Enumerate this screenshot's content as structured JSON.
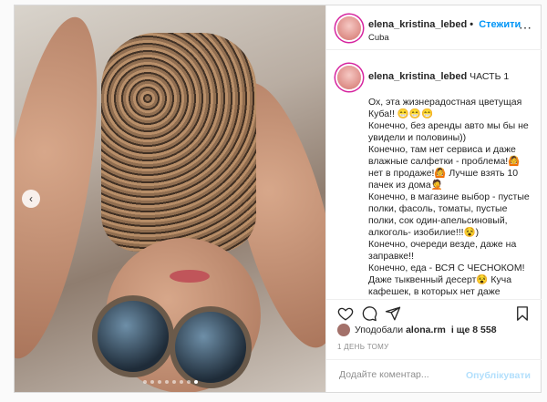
{
  "post": {
    "username": "elena_kristina_lebed",
    "follow_label": "Стежити",
    "location": "Cuba",
    "more_icon": "more-horizontal-icon"
  },
  "caption": {
    "username": "elena_kristina_lebed",
    "title": "ЧАСТЬ 1",
    "text": "Ох, эта жизнерадостная цветущая Куба!! 😁😁😁\nКонечно, без аренды авто мы бы не увидели и половины))\nКонечно, там нет сервиса и даже влажные салфетки - проблема!🙆 нет в продаже!🙆 Лучше взять 10 пачек из дома🤦\nКонечно, в магазине выбор - пустые полки, фасоль, томаты, пустые полки, сок один-апельсиновый, алкоголь- изобилие!!!😵)\nКонечно, очереди везде, даже на заправке!!\nКонечно, еда - ВСЯ С ЧЕСНОКОМ!\nДаже тыквенный десерт😵 Куча кафешек, в которых нет даже"
  },
  "likes": {
    "prefix": "Уподобали",
    "user": "alona.rm",
    "suffix": "і ще 8 558"
  },
  "timestamp": "1 ДЕНЬ ТОМУ",
  "comment": {
    "placeholder": "Додайте коментар...",
    "publish_label": "Опублікувати"
  },
  "carousel": {
    "slide_count": 8,
    "active_index": 7
  },
  "colors": {
    "accent": "#0095f6",
    "publish_disabled": "#b2dffc",
    "story_ring": "#d6249f"
  }
}
